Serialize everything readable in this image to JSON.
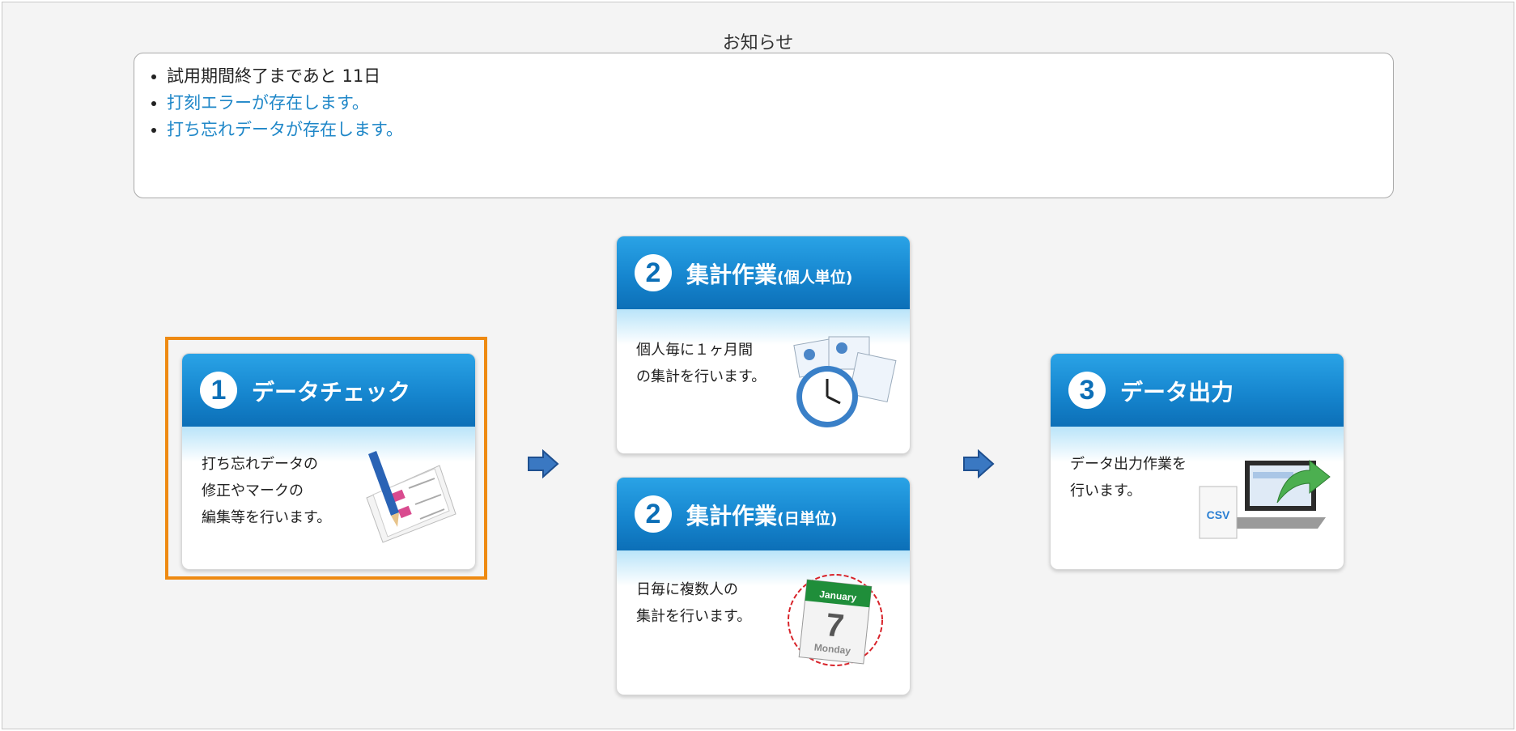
{
  "notice": {
    "title": "お知らせ",
    "items": [
      {
        "text": "試用期間終了まであと 11日",
        "link": false
      },
      {
        "text": "打刻エラーが存在します。",
        "link": true
      },
      {
        "text": "打ち忘れデータが存在します。",
        "link": true
      }
    ]
  },
  "cards": {
    "data_check": {
      "number": "1",
      "title": "データチェック",
      "desc": "打ち忘れデータの\n修正やマークの\n編集等を行います。"
    },
    "personal": {
      "number": "2",
      "title": "集計作業",
      "subtitle": "(個人単位)",
      "desc": "個人毎に１ヶ月間\nの集計を行います。"
    },
    "daily": {
      "number": "2",
      "title": "集計作業",
      "subtitle": "(日単位)",
      "desc": "日毎に複数人の\n集計を行います。"
    },
    "output": {
      "number": "3",
      "title": "データ出力",
      "desc": "データ出力作業を\n行います。"
    }
  },
  "calendar": {
    "month": "January",
    "day": "7",
    "weekday": "Monday"
  },
  "csv_label": "CSV",
  "colors": {
    "accent": "#1686cf",
    "highlight": "#ee8a12",
    "link": "#1f87c8"
  }
}
